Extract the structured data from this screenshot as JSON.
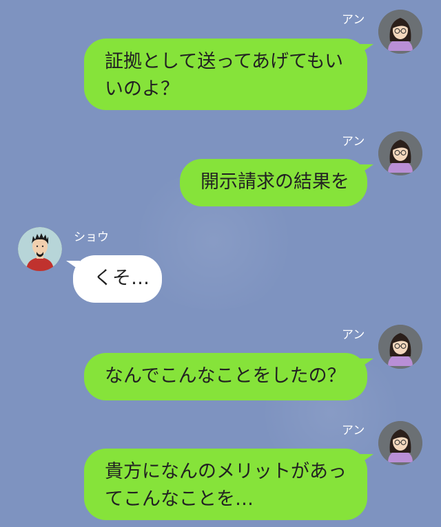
{
  "participants": {
    "self_name": "アン",
    "other_name": "ショウ"
  },
  "messages": [
    {
      "sender": "アン",
      "lines": [
        "証拠として送ってあげてもい",
        "いのよ？"
      ]
    },
    {
      "sender": "アン",
      "lines": [
        "開示請求の結果を"
      ]
    },
    {
      "sender": "ショウ",
      "lines": [
        "くそ…"
      ]
    },
    {
      "sender": "アン",
      "lines": [
        "なんでこんなことをしたの？"
      ]
    },
    {
      "sender": "アン",
      "lines": [
        "貴方になんのメリットがあっ",
        "てこんなことを…"
      ]
    }
  ],
  "colors": {
    "background": "#7e93c0",
    "outgoing_bubble": "#86e33a",
    "incoming_bubble": "#ffffff",
    "name_text": "#ffffff"
  },
  "icons": {
    "self_avatar": "woman-with-glasses-avatar",
    "other_avatar": "man-with-goatee-avatar"
  }
}
